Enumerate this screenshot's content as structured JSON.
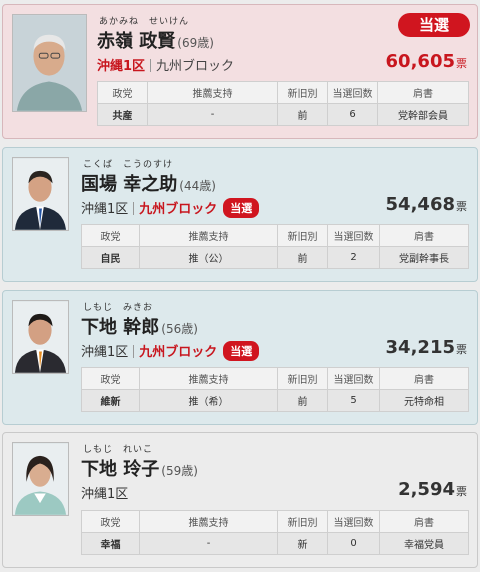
{
  "table_headers": [
    "政党",
    "推薦支持",
    "新旧別",
    "当選回数",
    "肩書"
  ],
  "vote_unit": "票",
  "colors": {
    "winner_red": "#c8161e",
    "badge_red": "#d0151f",
    "winner_bg": "#f3dfe1",
    "pr_bg": "#dde9ec",
    "lose_bg": "#ececec"
  },
  "candidates": [
    {
      "furigana": "あかみね　せいけん",
      "name": "赤嶺 政賢",
      "age": "(69歳)",
      "district": "沖縄1区",
      "block": "九州ブロック",
      "badge": "当選",
      "votes": "60,605",
      "party": "共産",
      "support": "-",
      "status": "前",
      "terms": "6",
      "title": "党幹部会員",
      "photo_icon": "candidate-photo"
    },
    {
      "furigana": "こくば　こうのすけ",
      "name": "国場 幸之助",
      "age": "(44歳)",
      "district": "沖縄1区",
      "block": "九州ブロック",
      "badge": "当選",
      "votes": "54,468",
      "party": "自民",
      "support": "推（公）",
      "status": "前",
      "terms": "2",
      "title": "党副幹事長",
      "photo_icon": "candidate-photo"
    },
    {
      "furigana": "しもじ　みきお",
      "name": "下地 幹郎",
      "age": "(56歳)",
      "district": "沖縄1区",
      "block": "九州ブロック",
      "badge": "当選",
      "votes": "34,215",
      "party": "維新",
      "support": "推（希）",
      "status": "前",
      "terms": "5",
      "title": "元特命相",
      "photo_icon": "candidate-photo"
    },
    {
      "furigana": "しもじ　れいこ",
      "name": "下地 玲子",
      "age": "(59歳)",
      "district": "沖縄1区",
      "votes": "2,594",
      "party": "幸福",
      "support": "-",
      "status": "新",
      "terms": "0",
      "title": "幸福党員",
      "photo_icon": "candidate-photo"
    }
  ]
}
